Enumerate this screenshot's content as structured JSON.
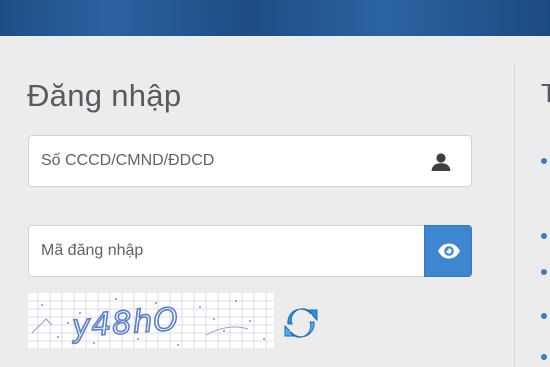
{
  "login": {
    "title": "Đăng nhập",
    "id_field": {
      "placeholder": "Số CCCD/CMND/ĐDCD",
      "value": ""
    },
    "password_field": {
      "placeholder": "Mã đăng nhập",
      "value": ""
    },
    "captcha_text": "y48hO"
  },
  "right_panel": {
    "heading_partial": "T"
  },
  "colors": {
    "banner": "#1e4f86",
    "accent": "#3d87d0",
    "title_text": "#555b63",
    "bullet": "#3a7dc4",
    "captcha_text": "#5b7fc9"
  },
  "icons": {
    "id_field": "user-icon",
    "toggle_visibility": "eye-icon",
    "captcha_refresh": "refresh-icon"
  }
}
